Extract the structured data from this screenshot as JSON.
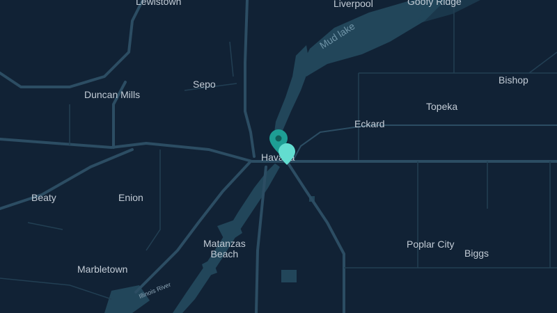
{
  "map": {
    "background_color": "#112235",
    "road_color": "#2a4a5f",
    "water_color": "#22465a",
    "labels": {
      "lewistown": "Lewistown",
      "liverpool": "Liverpool",
      "goofy_ridge": "Goofy Ridge",
      "mud_lake": "Mud lake",
      "bishop": "Bishop",
      "duncan_mills": "Duncan Mills",
      "sepo": "Sepo",
      "topeka": "Topeka",
      "eckard": "Eckard",
      "havana": "Havana",
      "beaty": "Beaty",
      "enion": "Enion",
      "matanzas_beach": "Matanzas\nBeach",
      "poplar_city": "Poplar City",
      "biggs": "Biggs",
      "marbletown": "Marbletown",
      "illinois_river": "Illinois River"
    },
    "markers": [
      {
        "name": "marker-dark",
        "color": "#1e9e94"
      },
      {
        "name": "marker-light",
        "color": "#63ddd0"
      }
    ]
  }
}
